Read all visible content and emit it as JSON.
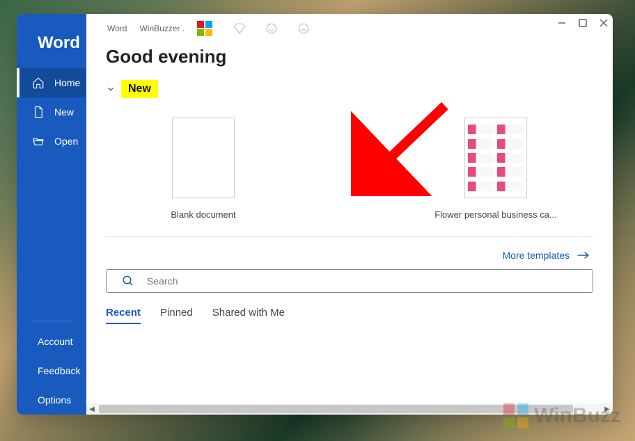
{
  "app": {
    "name": "Word"
  },
  "titlebar": {
    "left1": "Word",
    "left2": "WinBuzzer ."
  },
  "sidebar": {
    "items": [
      {
        "label": "Home"
      },
      {
        "label": "New"
      },
      {
        "label": "Open"
      }
    ],
    "bottom": [
      {
        "label": "Account"
      },
      {
        "label": "Feedback"
      },
      {
        "label": "Options"
      }
    ]
  },
  "main": {
    "greeting": "Good evening",
    "section_new": "New",
    "templates": [
      {
        "label": "Blank document"
      },
      {
        "label": "Flower personal business ca..."
      }
    ],
    "more_templates": "More templates",
    "search_placeholder": "Search",
    "tabs": [
      {
        "label": "Recent"
      },
      {
        "label": "Pinned"
      },
      {
        "label": "Shared with Me"
      }
    ]
  },
  "watermark": "WinBuzz"
}
